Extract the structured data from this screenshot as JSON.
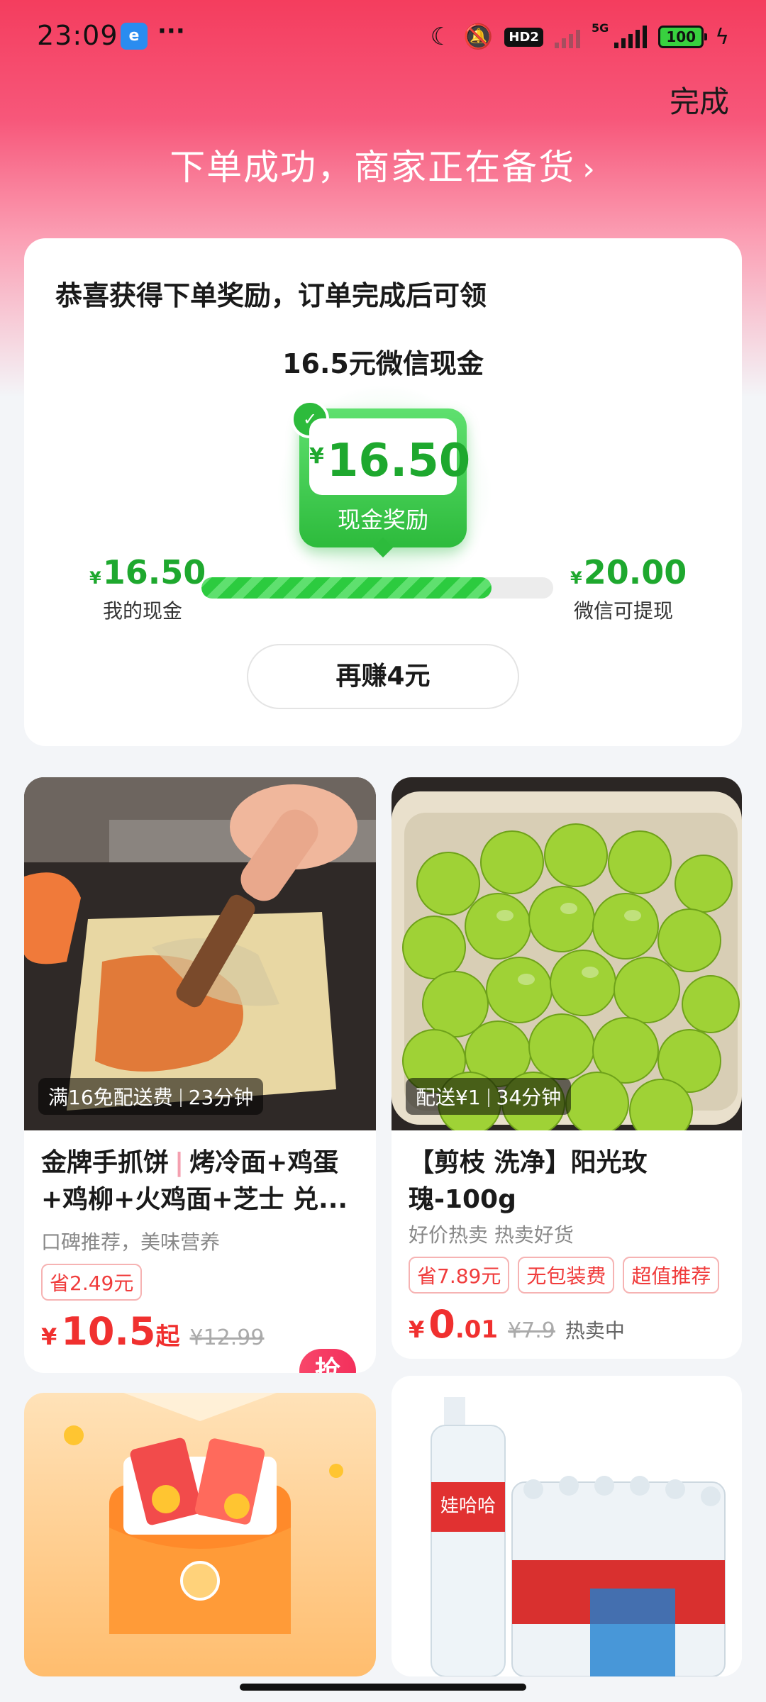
{
  "status_bar": {
    "time": "23:09",
    "app_icon_text": "e",
    "more": "···",
    "hd_badge": "HD2",
    "network": "5G",
    "battery": "100"
  },
  "header": {
    "done_label": "完成",
    "order_status": "下单成功，商家正在备货",
    "chevron": "›"
  },
  "reward": {
    "title": "恭喜获得下单奖励，订单完成后可领",
    "cash_title": "16.5元微信现金",
    "coupon_amount": "16.50",
    "coupon_label": "现金奖励",
    "currency": "¥",
    "my_cash_amount": "16.50",
    "my_cash_label": "我的现金",
    "withdraw_amount": "20.00",
    "withdraw_label": "微信可提现",
    "progress": 0.825,
    "earn_more_label": "再赚4元"
  },
  "products": [
    {
      "delivery": "满16免配送费",
      "eta": "23分钟",
      "title_brand": "金牌手抓饼",
      "title_rest": "烤冷面+鸡蛋+鸡柳+火鸡面+芝士 兑...",
      "subtitle": "口碑推荐，美味营养",
      "chips": [
        "省2.49元"
      ],
      "price_int": "10.5",
      "price_suffix": "起",
      "old_price": "¥12.99",
      "grab_label": "抢"
    },
    {
      "delivery": "配送¥1",
      "eta": "34分钟",
      "title": "【剪枝 洗净】阳光玫瑰-100g",
      "subtitle": "好价热卖 热卖好货",
      "chips": [
        "省7.89元",
        "无包装费",
        "超值推荐"
      ],
      "price_int": "0",
      "price_dec": ".01",
      "old_price": "¥7.9",
      "note": "热卖中"
    }
  ],
  "colors": {
    "brand_red": "#f43d5e",
    "reward_green": "#1ea82e",
    "price_red": "#f0302f"
  }
}
